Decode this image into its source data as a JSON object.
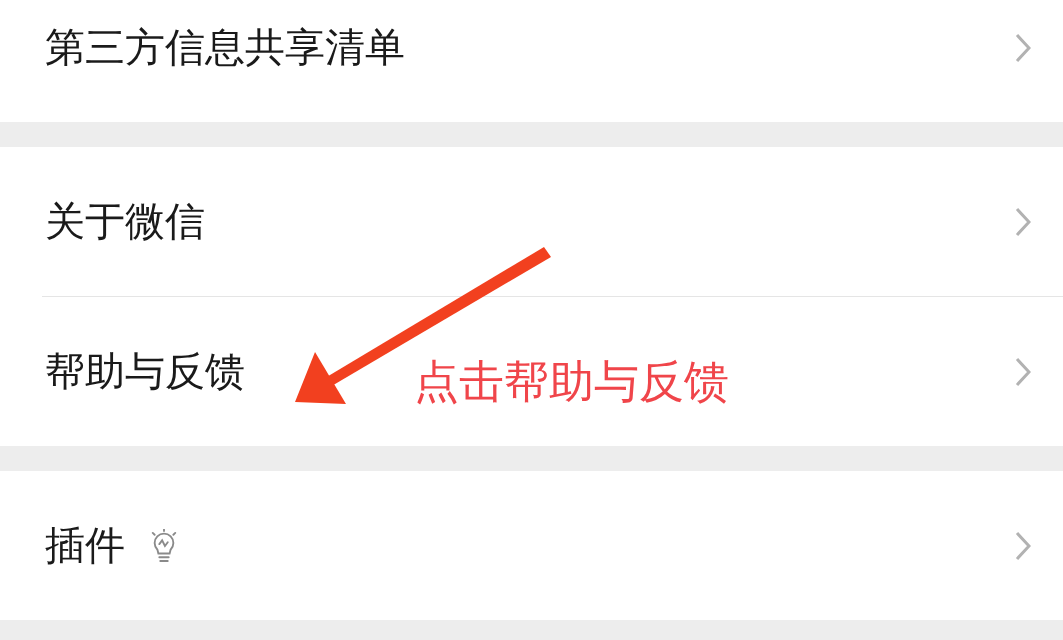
{
  "sections": [
    {
      "items": [
        {
          "label": "第三方信息共享清单",
          "kind": "plain"
        }
      ]
    },
    {
      "items": [
        {
          "label": "关于微信",
          "kind": "plain"
        },
        {
          "label": "帮助与反馈",
          "kind": "plain"
        }
      ]
    },
    {
      "items": [
        {
          "label": "插件",
          "kind": "with-icon"
        }
      ]
    }
  ],
  "annotation": {
    "text": "点击帮助与反馈"
  }
}
